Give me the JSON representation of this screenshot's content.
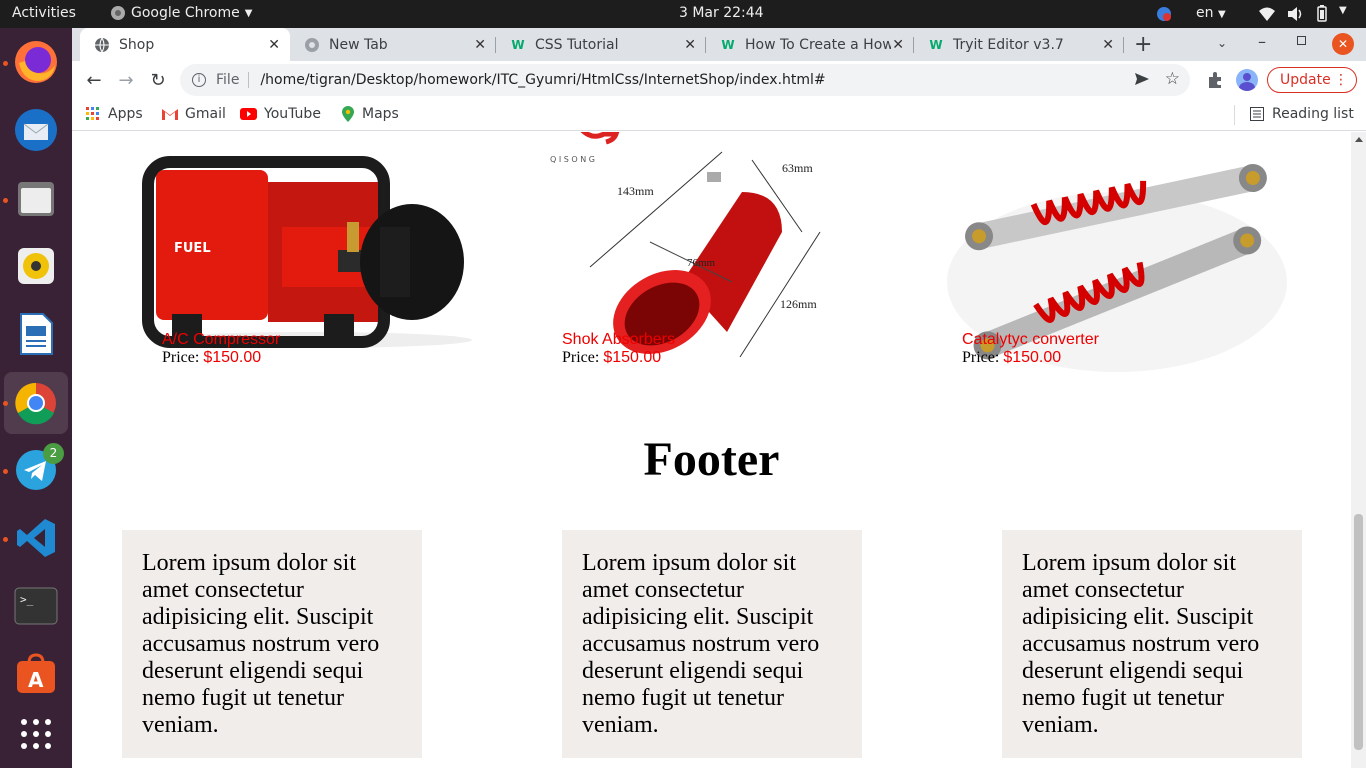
{
  "topbar": {
    "activities": "Activities",
    "app_name": "Google Chrome",
    "datetime": "3 Mar  22:44",
    "language": "en"
  },
  "dock": {
    "telegram_badge": "2"
  },
  "tabs": [
    {
      "label": "Shop"
    },
    {
      "label": "New Tab"
    },
    {
      "label": "CSS Tutorial"
    },
    {
      "label": "How To Create a How"
    },
    {
      "label": "Tryit Editor v3.7"
    }
  ],
  "toolbar": {
    "file_label": "File",
    "url": "/home/tigran/Desktop/homework/ITC_Gyumri/HtmlCss/InternetShop/index.html#",
    "update_label": "Update"
  },
  "bookmarks": {
    "apps": "Apps",
    "gmail": "Gmail",
    "youtube": "YouTube",
    "maps": "Maps",
    "reading_list": "Reading list"
  },
  "products": [
    {
      "name": "A/C Compressor",
      "price_label": "Price:",
      "price": "$150.00"
    },
    {
      "name": "Shok Absorbers",
      "price_label": "Price:",
      "price": "$150.00"
    },
    {
      "name": "Catalytyc converter",
      "price_label": "Price:",
      "price": "$150.00"
    }
  ],
  "image_text": {
    "brand": "FUEL",
    "qisong": "Q I S O N G",
    "dim1": "143mm",
    "dim2": "63mm",
    "dim3": "76mm",
    "dim4": "126mm"
  },
  "footer": {
    "title": "Footer",
    "boxes": [
      "Lorem ipsum dolor sit amet consectetur adipisicing elit. Suscipit accusamus nostrum vero deserunt eligendi sequi nemo fugit ut tenetur veniam.",
      "Lorem ipsum dolor sit amet consectetur adipisicing elit. Suscipit accusamus nostrum vero deserunt eligendi sequi nemo fugit ut tenetur veniam.",
      "Lorem ipsum dolor sit amet consectetur adipisicing elit. Suscipit accusamus nostrum vero deserunt eligendi sequi nemo fugit ut tenetur veniam."
    ]
  },
  "colors": {
    "accent_red": "#ee0000",
    "footer_box_bg": "#f1edeb",
    "dock_bg": "#3a2236"
  }
}
